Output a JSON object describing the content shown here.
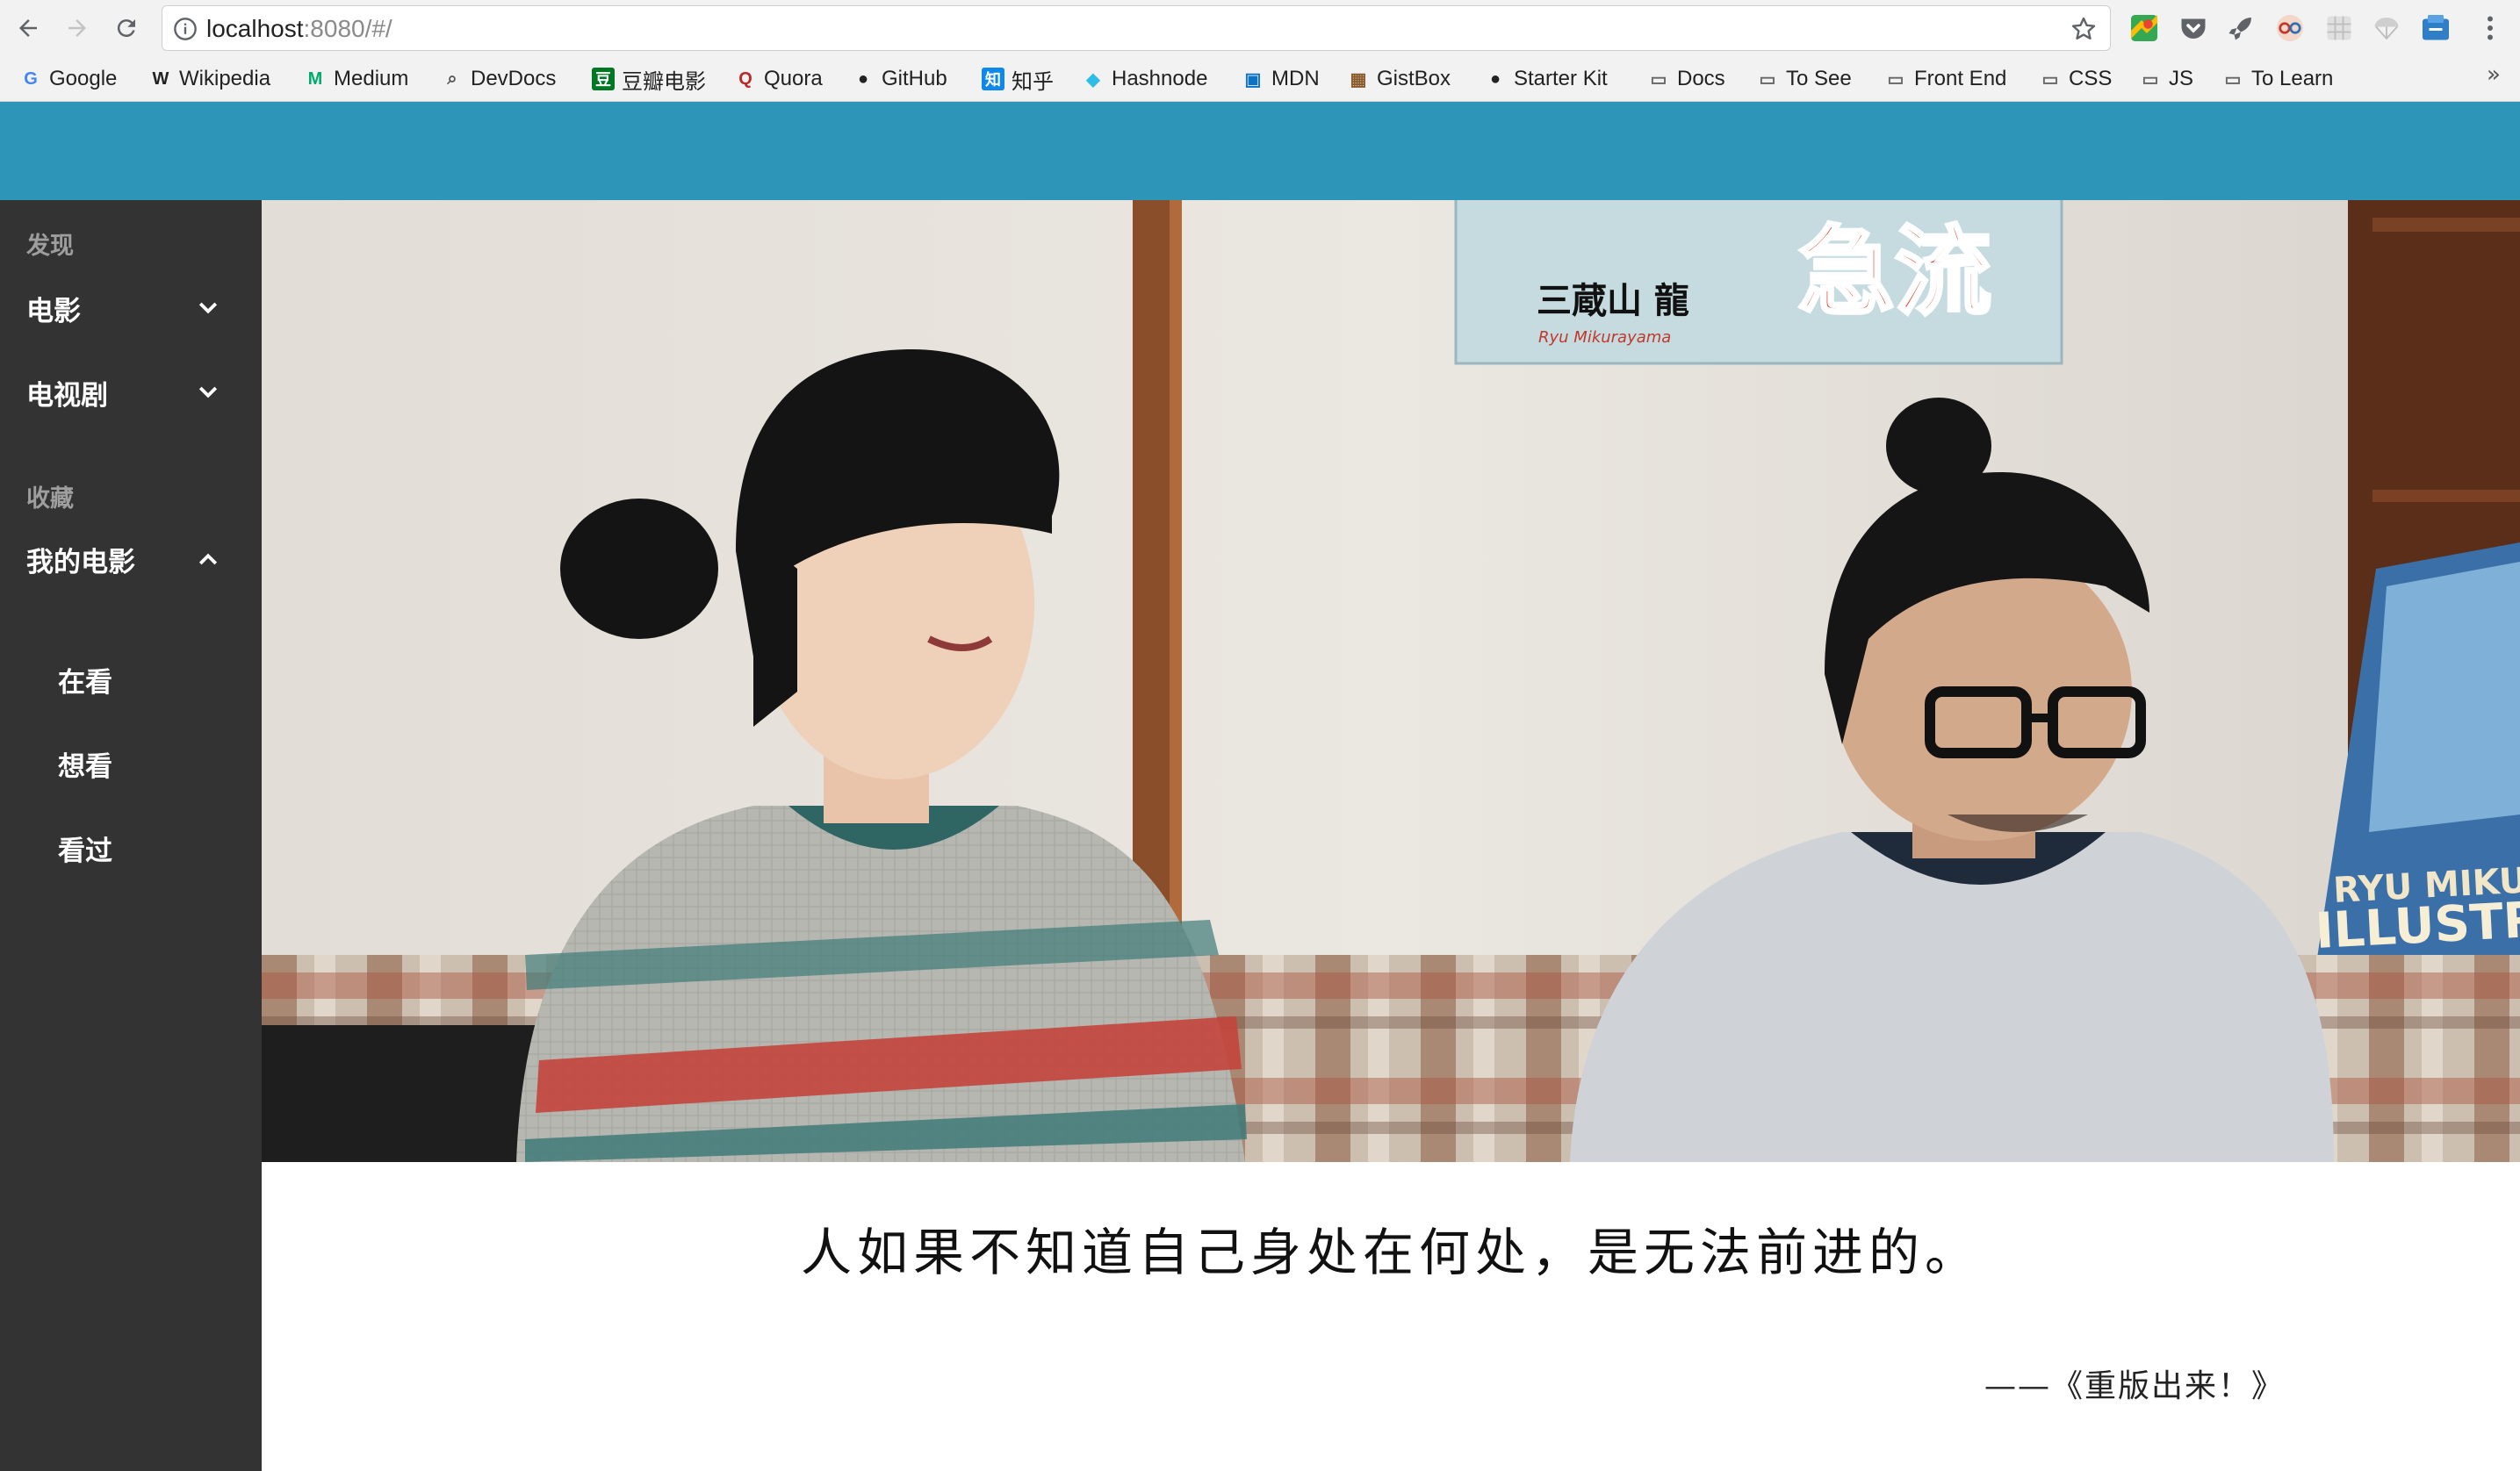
{
  "browser": {
    "url_host": "localhost",
    "url_rest": ":8080/#/",
    "bookmarks": [
      {
        "label": "Google",
        "icon": "google-icon",
        "color": "#4285f4"
      },
      {
        "label": "Wikipedia",
        "icon": "wikipedia-icon",
        "color": "#222222"
      },
      {
        "label": "Medium",
        "icon": "medium-icon",
        "color": "#00ab6c"
      },
      {
        "label": "DevDocs",
        "icon": "devdocs-icon",
        "color": "#555555"
      },
      {
        "label": "豆瓣电影",
        "icon": "douban-icon",
        "color": "#007722"
      },
      {
        "label": "Quora",
        "icon": "quora-icon",
        "color": "#b92b27"
      },
      {
        "label": "GitHub",
        "icon": "github-icon",
        "color": "#222222"
      },
      {
        "label": "知乎",
        "icon": "zhihu-icon",
        "color": "#0f88eb"
      },
      {
        "label": "Hashnode",
        "icon": "hashnode-icon",
        "color": "#2ebde6"
      },
      {
        "label": "MDN",
        "icon": "mdn-icon",
        "color": "#0b72c5"
      },
      {
        "label": "GistBox",
        "icon": "gistbox-icon",
        "color": "#8a5a2b"
      },
      {
        "label": "Starter Kit",
        "icon": "github-icon",
        "color": "#222222"
      },
      {
        "label": "Docs",
        "icon": "folder-icon",
        "color": "#666666"
      },
      {
        "label": "To See",
        "icon": "folder-icon",
        "color": "#666666"
      },
      {
        "label": "Front End",
        "icon": "folder-icon",
        "color": "#666666"
      },
      {
        "label": "CSS",
        "icon": "folder-icon",
        "color": "#666666"
      },
      {
        "label": "JS",
        "icon": "folder-icon",
        "color": "#666666"
      },
      {
        "label": "To Learn",
        "icon": "folder-icon",
        "color": "#666666"
      }
    ],
    "bookmarks_more": "»"
  },
  "theme": {
    "header_color": "#2d95b8",
    "sidebar_color": "#333333"
  },
  "sidebar": {
    "discover_label": "发现",
    "movies_label": "电影",
    "tv_label": "电视剧",
    "favorites_label": "收藏",
    "my_movies_label": "我的电影",
    "watching_label": "在看",
    "want_label": "想看",
    "watched_label": "看过"
  },
  "hero": {
    "poster_title": "急流",
    "poster_name": "三蔵山 龍",
    "poster_romaji": "Ryu Mikurayama",
    "book_line1": "RYU MIKUR",
    "book_line2": "ILLUSTRAT"
  },
  "quote": {
    "text": "人如果不知道自己身处在何处，是无法前进的。",
    "source": "——《重版出来！》"
  }
}
